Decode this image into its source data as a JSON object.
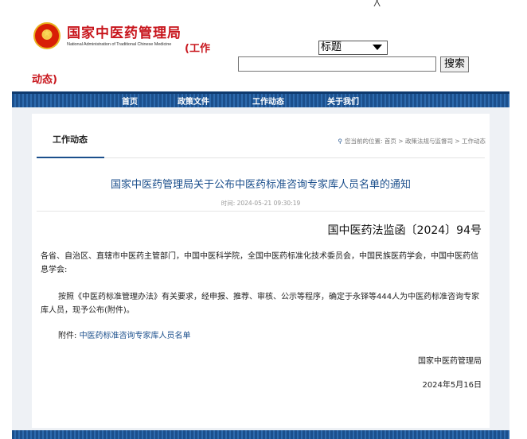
{
  "header": {
    "top_mark": "╳",
    "site_name_cn": "国家中医药管理局",
    "site_name_en": "National Administration of Traditional Chinese Medicine",
    "section_a": "(工作",
    "section_b": "动态)"
  },
  "search": {
    "scope_selected": "标题",
    "input_value": "",
    "button_label": "搜索"
  },
  "nav": {
    "items": [
      "首页",
      "政策文件",
      "工作动态",
      "关于我们"
    ]
  },
  "content": {
    "tab_title": "工作动态",
    "location": "您当前的位置: 首页 > 政策法规与监督司 > 工作动态",
    "article_title": "国家中医药管理局关于公布中医药标准咨询专家库人员名单的通知",
    "time": "时间: 2024-05-21 09:30:19",
    "doc_number": "国中医药法监函〔2024〕94号",
    "paragraph1": "各省、自治区、直辖市中医药主管部门，中国中医科学院，全国中医药标准化技术委员会，中国民族医药学会，中国中医药信息学会:",
    "paragraph2": "按照《中医药标准管理办法》有关要求，经申报、推荐、审核、公示等程序，确定于永铎等444人为中医药标准咨询专家库人员，现予公布(附件)。",
    "attachment_label": "附件: ",
    "attachment_link": "中医药标准咨询专家库人员名单",
    "signature": "国家中医药管理局",
    "date": "2024年5月16日"
  },
  "colors": {
    "brand_red": "#c8161d",
    "nav_blue": "#1b4f8c"
  }
}
